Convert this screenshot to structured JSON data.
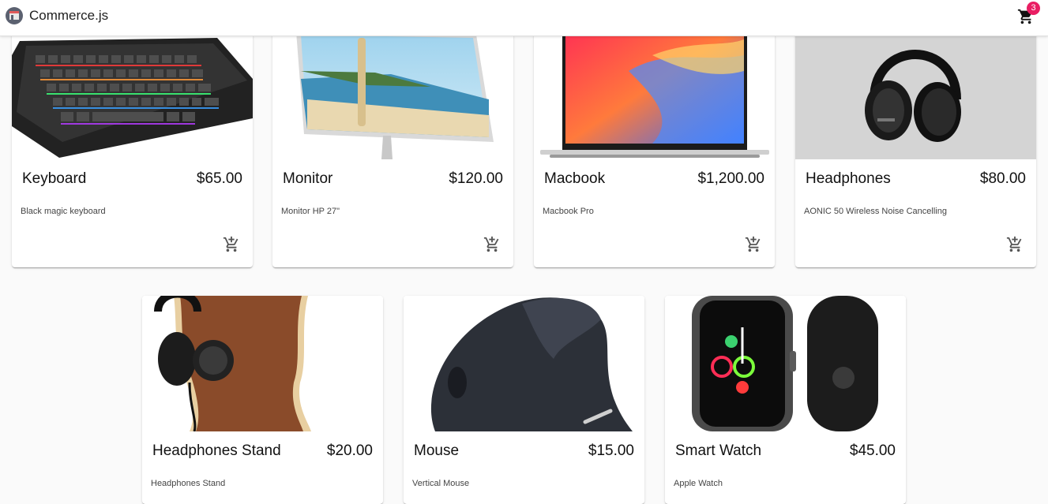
{
  "header": {
    "brand": "Commerce.js",
    "cart_count": "3",
    "logo_icon": "store-logo-icon",
    "cart_icon": "shopping-cart-icon",
    "badge_color": "#e91e63"
  },
  "products": [
    {
      "name": "Keyboard",
      "price": "$65.00",
      "description": "Black magic keyboard"
    },
    {
      "name": "Monitor",
      "price": "$120.00",
      "description": "Monitor HP 27\""
    },
    {
      "name": "Macbook",
      "price": "$1,200.00",
      "description": "Macbook Pro"
    },
    {
      "name": "Headphones",
      "price": "$80.00",
      "description": "AONIC 50 Wireless Noise Cancelling"
    },
    {
      "name": "Headphones Stand",
      "price": "$20.00",
      "description": "Headphones Stand"
    },
    {
      "name": "Mouse",
      "price": "$15.00",
      "description": "Vertical Mouse"
    },
    {
      "name": "Smart Watch",
      "price": "$45.00",
      "description": "Apple Watch"
    }
  ],
  "add_to_cart_icon": "add-shopping-cart-icon"
}
